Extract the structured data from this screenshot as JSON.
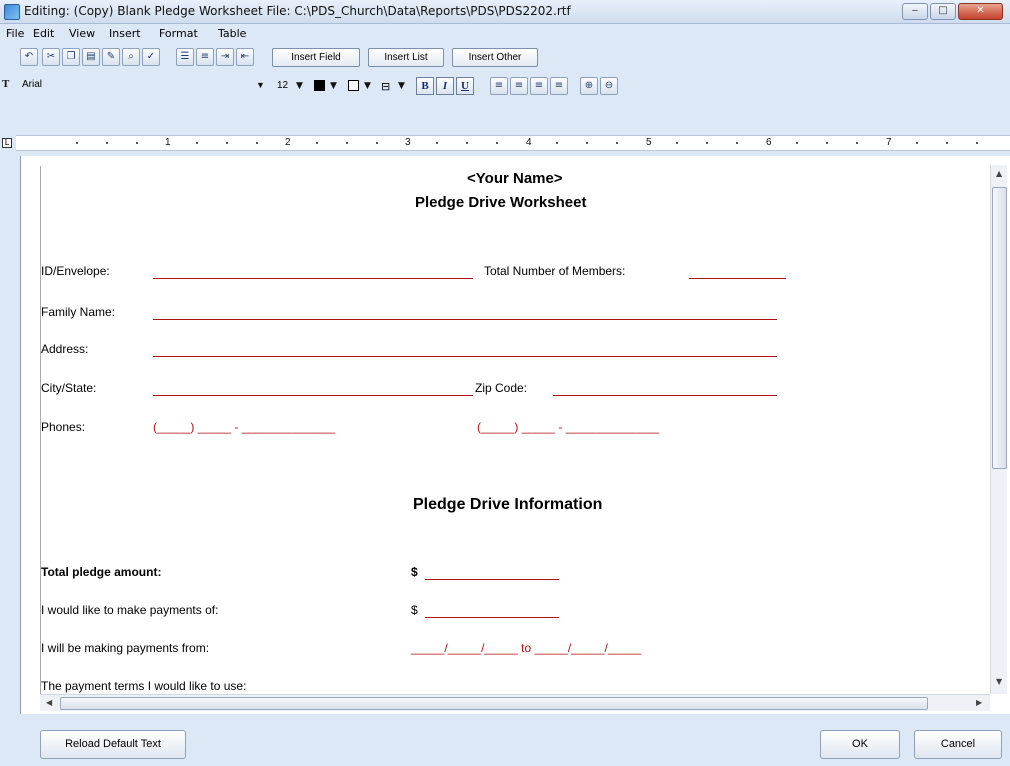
{
  "window": {
    "title": "Editing: (Copy) Blank Pledge Worksheet   File: C:\\PDS_Church\\Data\\Reports\\PDS\\PDS2202.rtf",
    "minimize": "‒",
    "maximize": "□",
    "close": "✕"
  },
  "menu": [
    "File",
    "Edit",
    "View",
    "Insert",
    "Format",
    "Table"
  ],
  "toolbar": {
    "insert_field": "Insert Field",
    "insert_list": "Insert List",
    "insert_other": "Insert Other"
  },
  "format_bar": {
    "font": "Arial",
    "size": "12",
    "bold": "B",
    "italic": "I",
    "underline": "U"
  },
  "ruler": [
    "1",
    "2",
    "3",
    "4",
    "5",
    "6",
    "7"
  ],
  "document": {
    "name_placeholder": "<Your Name>",
    "title": "Pledge Drive Worksheet",
    "id_label": "ID/Envelope:",
    "members_label": "Total Number of Members:",
    "family_label": "Family Name:",
    "address_label": "Address:",
    "city_label": "City/State:",
    "zip_label": "Zip Code:",
    "phones_label": "Phones:",
    "phone1": "(_____) _____ - ______________",
    "phone2": "(_____) _____ - ______________",
    "section_title": "Pledge Drive Information",
    "total_pledge_label": "Total pledge amount:",
    "dollar1": "$",
    "payments_of_label": "I would like to make payments of:",
    "dollar2": "$",
    "payments_from_label": "I will be making payments from:",
    "date_range": "_____/_____/_____   to   _____/_____/_____",
    "terms_label": "The payment terms I would like to use:"
  },
  "buttons": {
    "reload": "Reload Default Text",
    "ok": "OK",
    "cancel": "Cancel"
  }
}
